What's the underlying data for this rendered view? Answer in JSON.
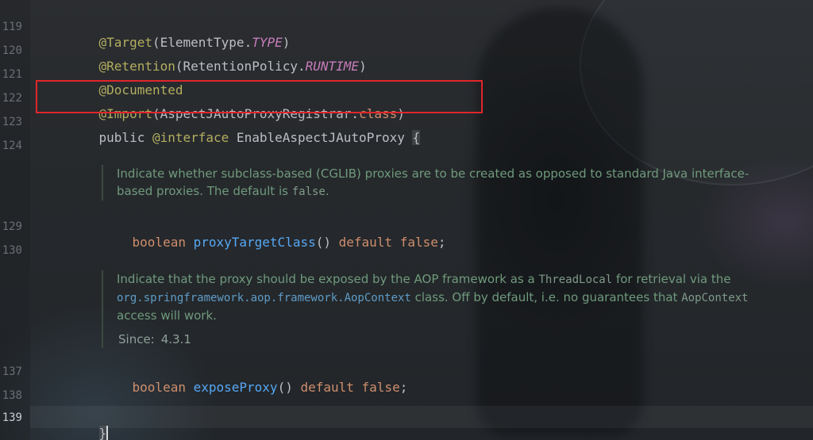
{
  "editor": {
    "line_numbers": [
      "119",
      "120",
      "121",
      "122",
      "123",
      "124",
      "129",
      "130",
      "137",
      "138",
      "139"
    ],
    "lines": {
      "l119": {
        "at": "@Target",
        "open": "(ElementType.",
        "const": "TYPE",
        "close": ")"
      },
      "l120": {
        "at": "@Retention",
        "open": "(RetentionPolicy.",
        "const": "RUNTIME",
        "close": ")"
      },
      "l121": {
        "at": "@Documented"
      },
      "l122": {
        "at": "@Import",
        "open": "(AspectJAutoProxyRegistrar.",
        "kw": "class",
        "close": ")"
      },
      "l123": {
        "kw1": "public ",
        "at": "@interface",
        "name": " EnableAspectJAutoProxy ",
        "brace": "{"
      },
      "l129": {
        "type": "boolean ",
        "method": "proxyTargetClass",
        "parens": "() ",
        "kw": "default false",
        "semi": ";"
      },
      "l137": {
        "type": "boolean ",
        "method": "exposeProxy",
        "parens": "() ",
        "kw": "default false",
        "semi": ";"
      },
      "l139": {
        "brace": "}"
      }
    },
    "doc1": {
      "text1": "Indicate whether subclass-based (CGLIB) proxies are to be created as opposed to standard Java interface-based proxies. The default is ",
      "code": "false",
      "text2": "."
    },
    "doc2": {
      "text1": "Indicate that the proxy should be exposed by the AOP framework as a ",
      "code1": "ThreadLocal",
      "text2": " for retrieval via the ",
      "link": "org.springframework.aop.framework.AopContext",
      "text3": " class. Off by default, i.e. no guarantees that ",
      "code2": "AopContext",
      "text4": " access will work.",
      "since_label": "Since:",
      "since_value": "4.3.1"
    },
    "highlight_color": "#e0262b"
  }
}
